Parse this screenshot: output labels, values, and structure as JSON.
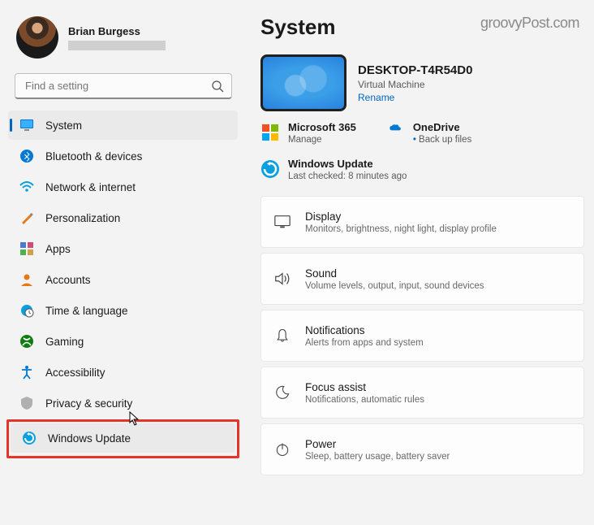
{
  "profile": {
    "name": "Brian Burgess"
  },
  "search": {
    "placeholder": "Find a setting"
  },
  "nav": [
    {
      "id": "system",
      "label": "System",
      "active": true
    },
    {
      "id": "bluetooth",
      "label": "Bluetooth & devices"
    },
    {
      "id": "network",
      "label": "Network & internet"
    },
    {
      "id": "personalization",
      "label": "Personalization"
    },
    {
      "id": "apps",
      "label": "Apps"
    },
    {
      "id": "accounts",
      "label": "Accounts"
    },
    {
      "id": "time",
      "label": "Time & language"
    },
    {
      "id": "gaming",
      "label": "Gaming"
    },
    {
      "id": "accessibility",
      "label": "Accessibility"
    },
    {
      "id": "privacy",
      "label": "Privacy & security"
    },
    {
      "id": "update",
      "label": "Windows Update",
      "highlighted": true,
      "hover": true
    }
  ],
  "main": {
    "title": "System",
    "watermark": "groovyPost.com",
    "device": {
      "name": "DESKTOP-T4R54D0",
      "type": "Virtual Machine",
      "rename": "Rename"
    },
    "services": {
      "m365": {
        "title": "Microsoft 365",
        "sub": "Manage"
      },
      "onedrive": {
        "title": "OneDrive",
        "sub": "Back up files"
      }
    },
    "update": {
      "title": "Windows Update",
      "sub": "Last checked: 8 minutes ago"
    },
    "cards": [
      {
        "id": "display",
        "title": "Display",
        "sub": "Monitors, brightness, night light, display profile"
      },
      {
        "id": "sound",
        "title": "Sound",
        "sub": "Volume levels, output, input, sound devices"
      },
      {
        "id": "notifications",
        "title": "Notifications",
        "sub": "Alerts from apps and system"
      },
      {
        "id": "focus",
        "title": "Focus assist",
        "sub": "Notifications, automatic rules"
      },
      {
        "id": "power",
        "title": "Power",
        "sub": "Sleep, battery usage, battery saver"
      }
    ]
  }
}
